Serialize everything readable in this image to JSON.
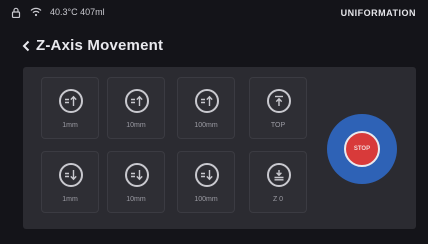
{
  "status": {
    "lock_icon": "lock-icon",
    "wifi_icon": "wifi-icon",
    "readout": "40.3°C 407ml",
    "brand": "UNIFORMATION"
  },
  "header": {
    "back_icon": "chevron-left-icon",
    "title": "Z-Axis Movement"
  },
  "buttons": {
    "up_1mm": {
      "label": "1mm",
      "icon": "move-up-icon"
    },
    "up_10mm": {
      "label": "10mm",
      "icon": "move-up-icon"
    },
    "up_100mm": {
      "label": "100mm",
      "icon": "move-up-icon"
    },
    "top": {
      "label": "TOP",
      "icon": "to-top-icon"
    },
    "down_1mm": {
      "label": "1mm",
      "icon": "move-down-icon"
    },
    "down_10mm": {
      "label": "10mm",
      "icon": "move-down-icon"
    },
    "down_100mm": {
      "label": "100mm",
      "icon": "move-down-icon"
    },
    "z0": {
      "label": "Z 0",
      "icon": "home-z-icon"
    }
  },
  "stop": {
    "label": "STOP"
  },
  "colors": {
    "background": "#141419",
    "panel": "#2b2b31",
    "stop_ring": "#2e62b6",
    "stop_button": "#d83a3a"
  }
}
